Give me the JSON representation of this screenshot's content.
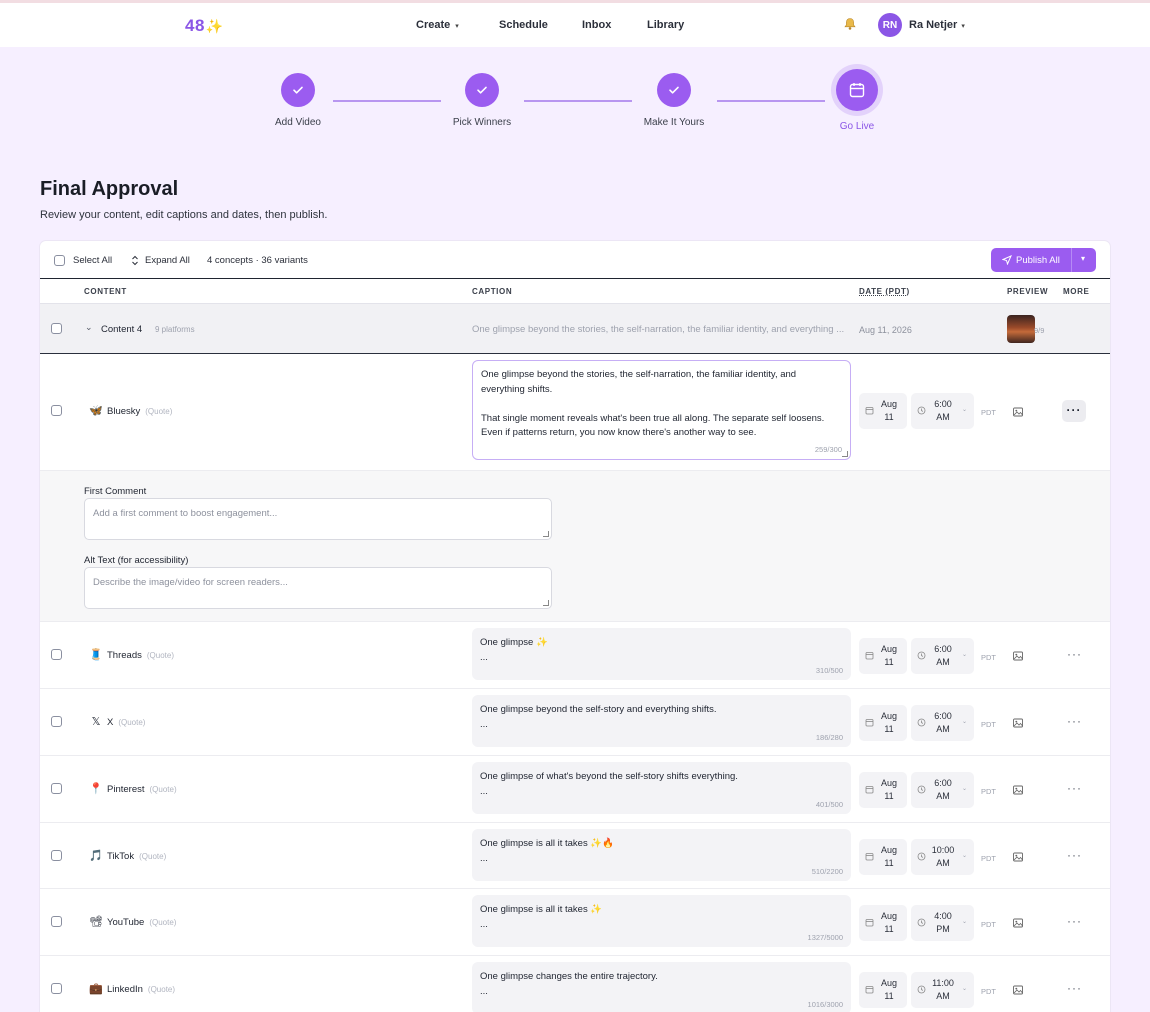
{
  "nav": {
    "logo": "48",
    "logo_spark": "✨",
    "items": [
      "Create",
      "Schedule",
      "Inbox",
      "Library"
    ],
    "create_caret": "▾",
    "avatar_initials": "RN",
    "user_name": "Ra Netjer",
    "user_caret": "▾"
  },
  "stepper": {
    "steps": [
      {
        "label": "Add Video",
        "status": "complete"
      },
      {
        "label": "Pick Winners",
        "status": "complete"
      },
      {
        "label": "Make It Yours",
        "status": "complete"
      },
      {
        "label": "Go Live",
        "status": "active"
      }
    ]
  },
  "page": {
    "title": "Final Approval",
    "subtitle": "Review your content, edit captions and dates, then publish."
  },
  "toolbar": {
    "select_all": "Select All",
    "expand_all": "Expand All",
    "summary": "4 concepts · 36 variants",
    "publish_all": "Publish All"
  },
  "columns": {
    "content": "CONTENT",
    "caption": "CAPTION",
    "date": "DATE (PDT)",
    "preview": "PREVIEW",
    "more": "MORE"
  },
  "group": {
    "name": "Content 4",
    "platforms": "9 platforms",
    "caption": "One glimpse beyond the stories, the self-narration, the familiar identity, and everything ...",
    "date": "Aug 11, 2026",
    "count": "9/9"
  },
  "expanded_row": {
    "platform": "Bluesky",
    "tag": "(Quote)",
    "caption": "One glimpse beyond the stories, the self-narration, the familiar identity, and everything shifts.\n\nThat single moment reveals what's been true all along. The separate self loosens. Even if patterns return, you now know there's another way to see.",
    "count": "259/300",
    "date_line1": "Aug",
    "date_line2": "11",
    "time_line1": "6:00",
    "time_line2": "AM",
    "tz": "PDT",
    "more": "···",
    "first_comment_label": "First Comment",
    "first_comment_placeholder": "Add a first comment to boost engagement...",
    "alt_text_label": "Alt Text (for accessibility)",
    "alt_text_placeholder": "Describe the image/video for screen readers..."
  },
  "rows": [
    {
      "platform": "Threads",
      "icon": "🧵",
      "tag": "(Quote)",
      "caption": "One glimpse ✨\n...",
      "count": "310/500",
      "date1": "Aug",
      "date2": "11",
      "time1": "6:00",
      "time2": "AM",
      "tz": "PDT"
    },
    {
      "platform": "X",
      "icon": "𝕏",
      "tag": "(Quote)",
      "caption": "One glimpse beyond the self-story and everything shifts.\n...",
      "count": "186/280",
      "date1": "Aug",
      "date2": "11",
      "time1": "6:00",
      "time2": "AM",
      "tz": "PDT"
    },
    {
      "platform": "Pinterest",
      "icon": "📍",
      "tag": "(Quote)",
      "caption": "One glimpse of what's beyond the self-story shifts everything.\n...",
      "count": "401/500",
      "date1": "Aug",
      "date2": "11",
      "time1": "6:00",
      "time2": "AM",
      "tz": "PDT"
    },
    {
      "platform": "TikTok",
      "icon": "🎵",
      "tag": "(Quote)",
      "caption": "One glimpse is all it takes ✨🔥\n...",
      "count": "510/2200",
      "date1": "Aug",
      "date2": "11",
      "time1": "10:00",
      "time2": "AM",
      "tz": "PDT"
    },
    {
      "platform": "YouTube",
      "icon": "📽",
      "tag": "(Quote)",
      "caption": "One glimpse is all it takes ✨\n...",
      "count": "1327/5000",
      "date1": "Aug",
      "date2": "11",
      "time1": "4:00",
      "time2": "PM",
      "tz": "PDT"
    },
    {
      "platform": "LinkedIn",
      "icon": "💼",
      "tag": "(Quote)",
      "caption": "One glimpse changes the entire trajectory.\n...",
      "count": "1016/3000",
      "date1": "Aug",
      "date2": "11",
      "time1": "11:00",
      "time2": "AM",
      "tz": "PDT"
    }
  ],
  "colors": {
    "accent": "#9b5cf0",
    "background": "#f6efff",
    "panel": "#ffffff"
  }
}
